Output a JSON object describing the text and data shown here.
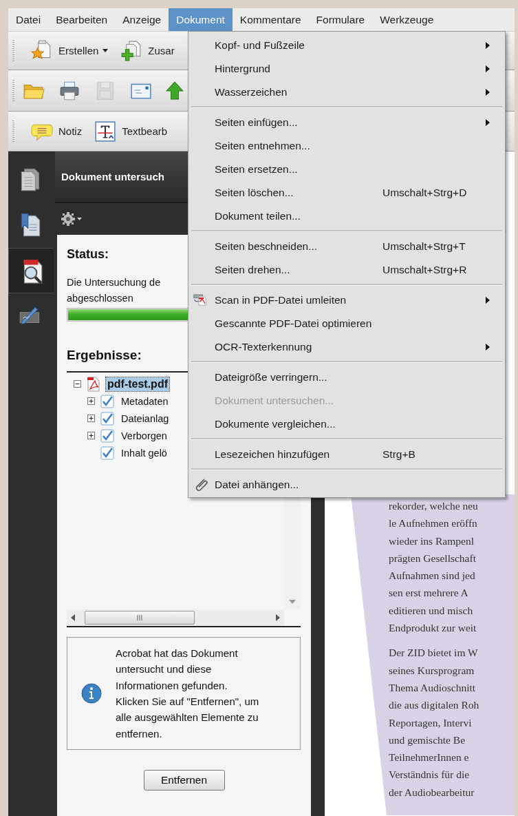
{
  "menubar": {
    "items": [
      {
        "label": "Datei",
        "selected": false
      },
      {
        "label": "Bearbeiten",
        "selected": false
      },
      {
        "label": "Anzeige",
        "selected": false
      },
      {
        "label": "Dokument",
        "selected": true
      },
      {
        "label": "Kommentare",
        "selected": false
      },
      {
        "label": "Formulare",
        "selected": false
      },
      {
        "label": "Werkzeuge",
        "selected": false
      }
    ]
  },
  "toolbars": [
    {
      "items": [
        {
          "label": "Erstellen",
          "kind": "create",
          "dropdown": true
        },
        {
          "label": "Zusar",
          "kind": "combine",
          "dropdown": false
        }
      ]
    },
    {
      "items": [
        {
          "kind": "folder",
          "disabled": false
        },
        {
          "kind": "print",
          "disabled": false
        },
        {
          "kind": "save",
          "disabled": true
        },
        {
          "kind": "mail",
          "disabled": false
        },
        {
          "kind": "upload",
          "disabled": false
        }
      ]
    },
    {
      "items": [
        {
          "label": "Notiz",
          "kind": "note"
        },
        {
          "label": "Textbearb",
          "kind": "textedit"
        }
      ]
    }
  ],
  "sidebar": {
    "items": [
      {
        "kind": "pages",
        "selected": false
      },
      {
        "kind": "bookmarks",
        "selected": false
      },
      {
        "kind": "inspect",
        "selected": true
      },
      {
        "kind": "signature",
        "selected": false
      }
    ]
  },
  "panel": {
    "title": "Dokument untersuch",
    "status_heading": "Status:",
    "status_lines": [
      "Die Untersuchung de",
      "abgeschlossen"
    ],
    "progress": {
      "level": 1
    },
    "results_heading": "Ergebnisse:",
    "tree": [
      {
        "label": "pdf-test.pdf",
        "expanded": true,
        "selected": true,
        "children": [
          {
            "label": "Metadaten",
            "expanded": false,
            "checked": true
          },
          {
            "label": "Dateianlag",
            "expanded": false,
            "checked": true
          },
          {
            "label": "Verborgen",
            "expanded": false,
            "checked": true
          },
          {
            "label": "Inhalt gelö",
            "checked": true
          }
        ]
      }
    ],
    "info_lines": [
      "Acrobat hat das Dokument",
      "untersucht und diese",
      "Informationen gefunden.",
      "Klicken Sie auf \"Entfernen\", um",
      "alle ausgewählten Elemente zu",
      "entfernen."
    ],
    "button": "Entfernen"
  },
  "menu": {
    "groups": [
      [
        {
          "label": "Kopf- und Fußzeile",
          "kind": "plain",
          "submenu": true,
          "disabled": false
        },
        {
          "label": "Hintergrund",
          "kind": "plain",
          "submenu": true,
          "disabled": false
        },
        {
          "label": "Wasserzeichen",
          "kind": "plain",
          "submenu": true,
          "disabled": false
        }
      ],
      [
        {
          "label": "Seiten einfügen...",
          "kind": "plain",
          "submenu": true,
          "disabled": false
        },
        {
          "label": "Seiten entnehmen...",
          "kind": "plain",
          "submenu": false,
          "disabled": false
        },
        {
          "label": "Seiten ersetzen...",
          "kind": "plain",
          "submenu": false,
          "disabled": false
        },
        {
          "label": "Seiten löschen...",
          "kind": "plain",
          "shortcut": "Umschalt+Strg+D",
          "submenu": false,
          "disabled": false
        },
        {
          "label": "Dokument teilen...",
          "kind": "plain",
          "submenu": false,
          "disabled": false
        }
      ],
      [
        {
          "label": "Seiten beschneiden...",
          "kind": "plain",
          "shortcut": "Umschalt+Strg+T",
          "submenu": false,
          "disabled": false
        },
        {
          "label": "Seiten drehen...",
          "kind": "plain",
          "shortcut": "Umschalt+Strg+R",
          "submenu": false,
          "disabled": false
        }
      ],
      [
        {
          "label": "Scan in PDF-Datei umleiten",
          "kind": "scan",
          "submenu": true,
          "disabled": false
        },
        {
          "label": "Gescannte PDF-Datei optimieren",
          "kind": "plain",
          "submenu": false,
          "disabled": false
        },
        {
          "label": "OCR-Texterkennung",
          "kind": "plain",
          "submenu": true,
          "disabled": false
        }
      ],
      [
        {
          "label": "Dateigröße verringern...",
          "kind": "plain",
          "submenu": false,
          "disabled": false
        },
        {
          "label": "Dokument untersuchen...",
          "kind": "plain",
          "submenu": false,
          "disabled": true
        },
        {
          "label": "Dokumente vergleichen...",
          "kind": "plain",
          "submenu": false,
          "disabled": false
        }
      ],
      [
        {
          "label": "Lesezeichen hinzufügen",
          "kind": "plain",
          "shortcut": "Strg+B",
          "submenu": false,
          "disabled": false
        }
      ],
      [
        {
          "label": "Datei anhängen...",
          "kind": "clip",
          "submenu": false,
          "disabled": false
        }
      ]
    ]
  },
  "document": {
    "paragraphs": [
      [
        "rekorder, welche neu",
        "le Aufnehmen eröffn",
        "wieder ins Rampenl",
        "prägten Gesellschaft",
        "Aufnahmen sind jed",
        "sen erst mehrere A",
        "editieren und misch",
        "Endprodukt zur weit"
      ],
      [
        "Der ZID bietet im W",
        "seines Kursprogram",
        "Thema Audioschnitt",
        "die aus digitalen Roh",
        "Reportagen, Intervi",
        "und gemischte Be",
        "TeilnehmerInnen e",
        "Verständnis für die",
        "der Audiobearbeitur"
      ]
    ]
  }
}
